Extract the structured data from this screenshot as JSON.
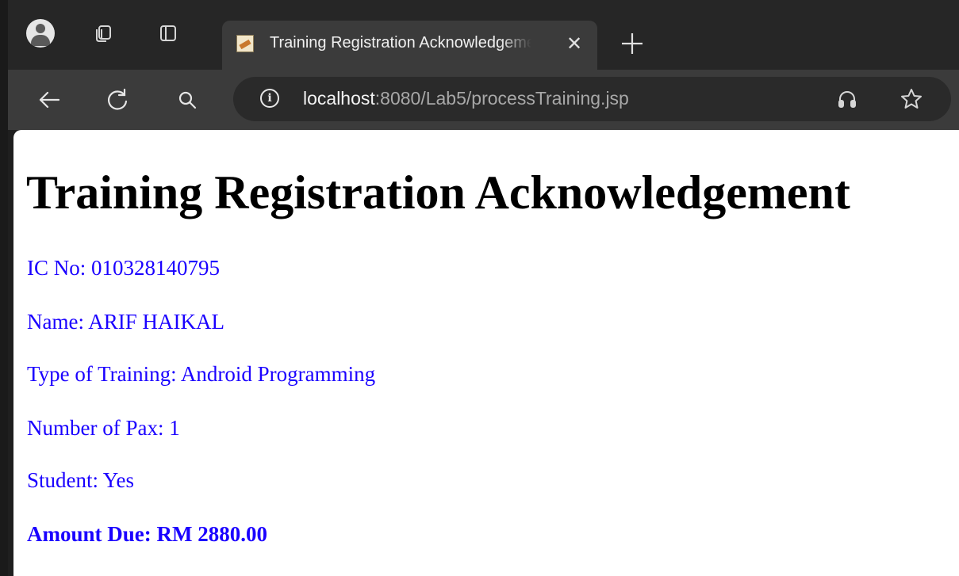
{
  "browser": {
    "tab": {
      "title": "Training Registration Acknowledgement",
      "close_glyph": "✕"
    },
    "new_tab_glyph": "+",
    "address": {
      "host": "localhost",
      "path": ":8080/Lab5/processTraining.jsp",
      "info_glyph": "i"
    },
    "icons": {
      "profile": "profile-avatar-icon",
      "workspaces": "workspaces-icon",
      "sidebar": "vertical-tabs-icon",
      "back": "back-arrow-icon",
      "reload": "reload-icon",
      "search": "search-icon",
      "read_aloud": "read-aloud-icon",
      "favorite": "favorite-star-icon"
    }
  },
  "page": {
    "heading": "Training Registration Acknowledgement",
    "ic_no": "IC No: 010328140795",
    "name": "Name: ARIF HAIKAL",
    "training_type": "Type of Training: Android Programming",
    "pax": "Number of Pax: 1",
    "student": "Student: Yes",
    "amount_due": "Amount Due: RM 2880.00"
  },
  "colors": {
    "text_blue": "#1a00ff",
    "chrome_dark": "#262626",
    "chrome_toolbar": "#3b3b3b"
  }
}
